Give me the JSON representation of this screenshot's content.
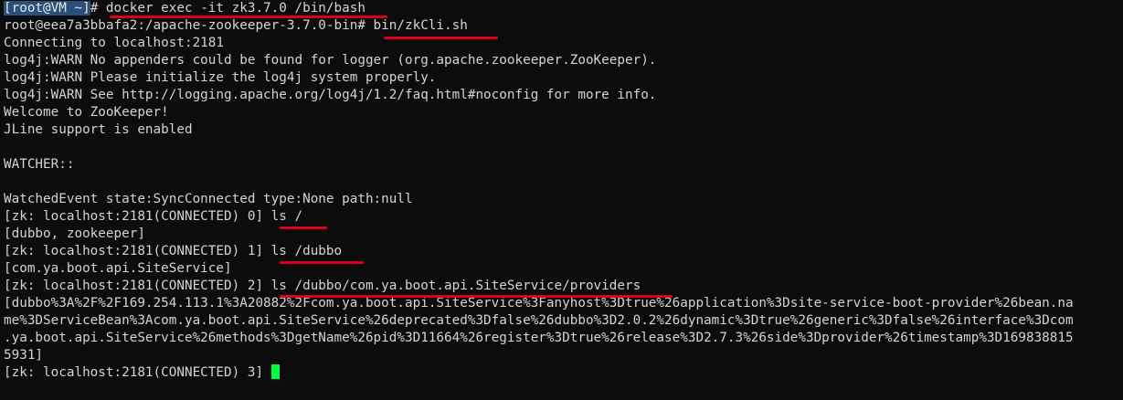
{
  "terminal": {
    "lines": [
      {
        "prompt": "[root@VM ~]",
        "rest": "# docker exec -it zk3.7.0 /bin/bash"
      },
      {
        "text": "root@eea7a3bbafa2:/apache-zookeeper-3.7.0-bin# bin/zkCli.sh"
      },
      {
        "text": "Connecting to localhost:2181"
      },
      {
        "text": "log4j:WARN No appenders could be found for logger (org.apache.zookeeper.ZooKeeper)."
      },
      {
        "text": "log4j:WARN Please initialize the log4j system properly."
      },
      {
        "text": "log4j:WARN See http://logging.apache.org/log4j/1.2/faq.html#noconfig for more info."
      },
      {
        "text": "Welcome to ZooKeeper!"
      },
      {
        "text": "JLine support is enabled"
      },
      {
        "text": ""
      },
      {
        "text": "WATCHER::"
      },
      {
        "text": ""
      },
      {
        "text": "WatchedEvent state:SyncConnected type:None path:null"
      },
      {
        "text": "[zk: localhost:2181(CONNECTED) 0] ls /"
      },
      {
        "text": "[dubbo, zookeeper]"
      },
      {
        "text": "[zk: localhost:2181(CONNECTED) 1] ls /dubbo"
      },
      {
        "text": "[com.ya.boot.api.SiteService]"
      },
      {
        "text": "[zk: localhost:2181(CONNECTED) 2] ls /dubbo/com.ya.boot.api.SiteService/providers"
      },
      {
        "text": "[dubbo%3A%2F%2F169.254.113.1%3A20882%2Fcom.ya.boot.api.SiteService%3Fanyhost%3Dtrue%26application%3Dsite-service-boot-provider%26bean.na"
      },
      {
        "text": "me%3DServiceBean%3Acom.ya.boot.api.SiteService%26deprecated%3Dfalse%26dubbo%3D2.0.2%26dynamic%3Dtrue%26generic%3Dfalse%26interface%3Dcom"
      },
      {
        "text": ".ya.boot.api.SiteService%26methods%3DgetName%26pid%3D11664%26register%3Dtrue%26release%3D2.7.3%26side%3Dprovider%26timestamp%3D169838815"
      },
      {
        "text": "5931]"
      },
      {
        "text": "[zk: localhost:2181(CONNECTED) 3] "
      }
    ]
  },
  "colors": {
    "background": "#0c0c0c",
    "foreground": "#d4d4d4",
    "prompt_highlight": "#2a4f7a",
    "cursor": "#00ff3c",
    "annotation_underline": "#d9001b"
  }
}
